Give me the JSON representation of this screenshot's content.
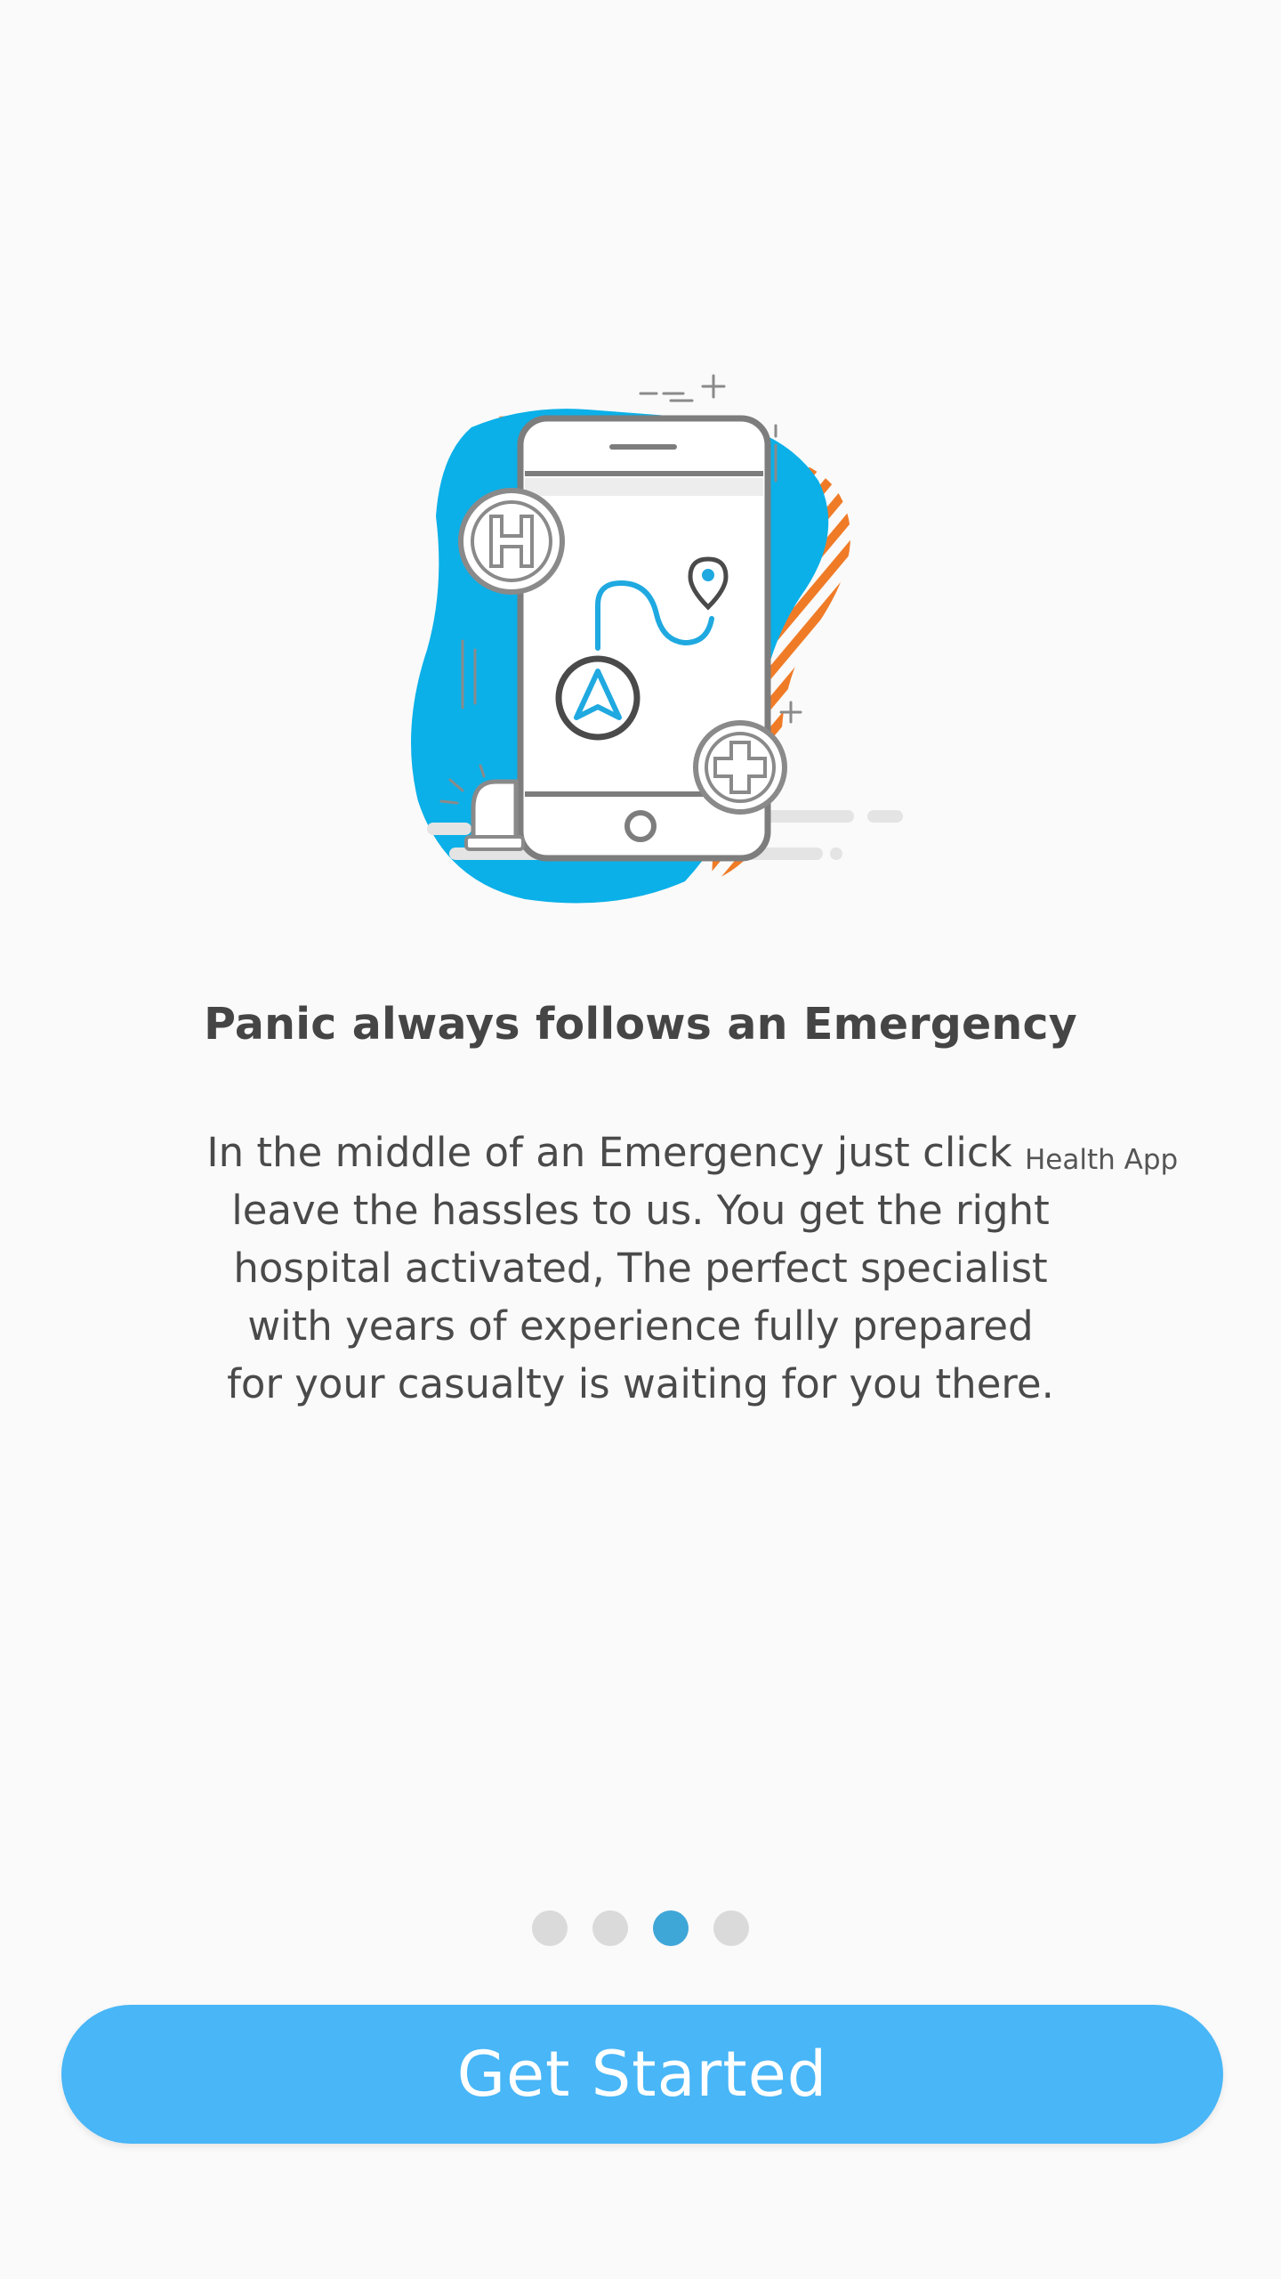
{
  "onboarding": {
    "title": "Panic always follows an Emergency",
    "body_lines": [
      "In the middle of an Emergency just click",
      "leave the hassles to us. You get the right",
      "hospital activated, The perfect specialist",
      "with years of experience fully prepared",
      "for your casualty is waiting for you there."
    ],
    "app_label": "Health App",
    "illustration": {
      "icons": [
        "smartphone-icon",
        "hospital-h-icon",
        "medical-cross-icon",
        "navigation-arrow-icon",
        "location-pin-icon",
        "siren-icon"
      ]
    }
  },
  "pager": {
    "total": 4,
    "active_index": 2
  },
  "cta": {
    "label": "Get Started"
  },
  "colors": {
    "accent_blue": "#48b6f7",
    "blob_blue": "#0bb0e8",
    "stripe_orange": "#f07b27",
    "dot_active": "#3fa6d8",
    "dot_inactive": "#dadada",
    "text_dark": "#454545"
  }
}
